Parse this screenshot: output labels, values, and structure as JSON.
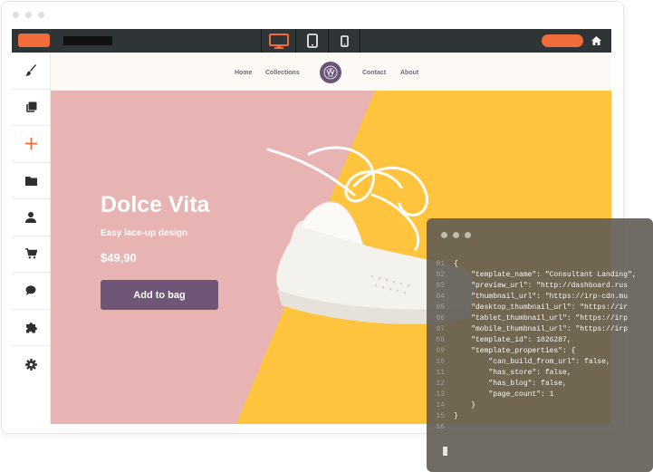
{
  "colors": {
    "accent": "#f26b3a",
    "topbar": "#2f3437",
    "hero_pink": "#e7b3b3",
    "hero_yellow": "#ffc43e",
    "button_purple": "#6f5677"
  },
  "topbar": {
    "devices": [
      {
        "icon": "desktop-icon",
        "active": true
      },
      {
        "icon": "tablet-icon",
        "active": false
      },
      {
        "icon": "mobile-icon",
        "active": false
      }
    ],
    "home_icon": "home-icon"
  },
  "sidebar": {
    "items": [
      {
        "icon": "brush-icon"
      },
      {
        "icon": "pages-icon"
      },
      {
        "icon": "plus-icon"
      },
      {
        "icon": "folder-icon"
      },
      {
        "icon": "user-icon"
      },
      {
        "icon": "cart-icon"
      },
      {
        "icon": "comment-icon"
      },
      {
        "icon": "puzzle-icon"
      },
      {
        "icon": "gear-icon"
      }
    ]
  },
  "site": {
    "nav": {
      "home": "Home",
      "collections": "Collections",
      "contact": "Contact",
      "about": "About"
    },
    "hero": {
      "title": "Dolce Vita",
      "subtitle": "Easy lace-up design",
      "price": "$49,90",
      "cta": "Add to bag"
    }
  },
  "code_panel": {
    "lines": [
      {
        "n": "01",
        "text": "{"
      },
      {
        "n": "02",
        "text": "    \"template_name\": \"Consultant Landing\","
      },
      {
        "n": "03",
        "text": "    \"preview_url\": \"http://dashboard.rus"
      },
      {
        "n": "04",
        "text": "    \"thumbnail_url\": \"https://irp-cdn.mu"
      },
      {
        "n": "05",
        "text": "    \"desktop_thumbnail_url\": \"https://ir"
      },
      {
        "n": "06",
        "text": "    \"tablet_thumbnail_url\": \"https://irp"
      },
      {
        "n": "07",
        "text": "    \"mobile_thumbnail_url\": \"https://irp"
      },
      {
        "n": "08",
        "text": "    \"template_id\": 1026287,"
      },
      {
        "n": "09",
        "text": "    \"template_properties\": {"
      },
      {
        "n": "10",
        "text": "        \"can_build_from_url\": false,"
      },
      {
        "n": "11",
        "text": "        \"has_store\": false,"
      },
      {
        "n": "12",
        "text": "        \"has_blog\": false,"
      },
      {
        "n": "13",
        "text": "        \"page_count\": 1"
      },
      {
        "n": "14",
        "text": "    }"
      },
      {
        "n": "15",
        "text": "}"
      },
      {
        "n": "16",
        "text": ""
      }
    ]
  }
}
